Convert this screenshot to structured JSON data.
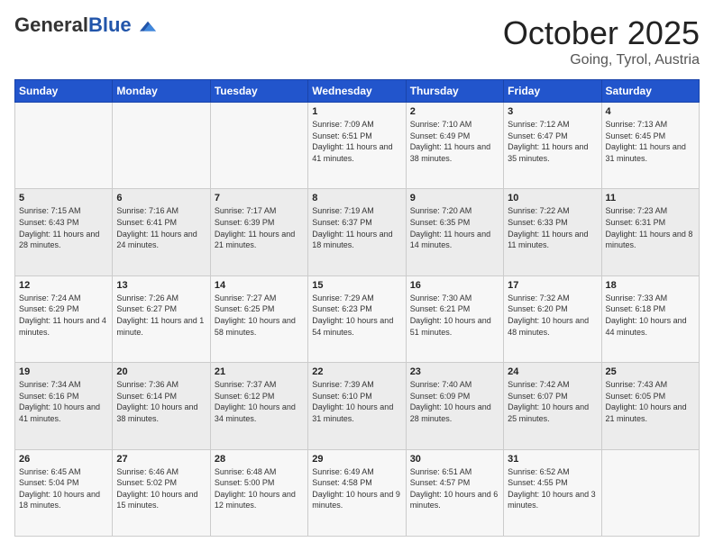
{
  "header": {
    "logo_general": "General",
    "logo_blue": "Blue",
    "month_title": "October 2025",
    "location": "Going, Tyrol, Austria"
  },
  "days_of_week": [
    "Sunday",
    "Monday",
    "Tuesday",
    "Wednesday",
    "Thursday",
    "Friday",
    "Saturday"
  ],
  "weeks": [
    [
      {
        "day": "",
        "sunrise": "",
        "sunset": "",
        "daylight": ""
      },
      {
        "day": "",
        "sunrise": "",
        "sunset": "",
        "daylight": ""
      },
      {
        "day": "",
        "sunrise": "",
        "sunset": "",
        "daylight": ""
      },
      {
        "day": "1",
        "sunrise": "Sunrise: 7:09 AM",
        "sunset": "Sunset: 6:51 PM",
        "daylight": "Daylight: 11 hours and 41 minutes."
      },
      {
        "day": "2",
        "sunrise": "Sunrise: 7:10 AM",
        "sunset": "Sunset: 6:49 PM",
        "daylight": "Daylight: 11 hours and 38 minutes."
      },
      {
        "day": "3",
        "sunrise": "Sunrise: 7:12 AM",
        "sunset": "Sunset: 6:47 PM",
        "daylight": "Daylight: 11 hours and 35 minutes."
      },
      {
        "day": "4",
        "sunrise": "Sunrise: 7:13 AM",
        "sunset": "Sunset: 6:45 PM",
        "daylight": "Daylight: 11 hours and 31 minutes."
      }
    ],
    [
      {
        "day": "5",
        "sunrise": "Sunrise: 7:15 AM",
        "sunset": "Sunset: 6:43 PM",
        "daylight": "Daylight: 11 hours and 28 minutes."
      },
      {
        "day": "6",
        "sunrise": "Sunrise: 7:16 AM",
        "sunset": "Sunset: 6:41 PM",
        "daylight": "Daylight: 11 hours and 24 minutes."
      },
      {
        "day": "7",
        "sunrise": "Sunrise: 7:17 AM",
        "sunset": "Sunset: 6:39 PM",
        "daylight": "Daylight: 11 hours and 21 minutes."
      },
      {
        "day": "8",
        "sunrise": "Sunrise: 7:19 AM",
        "sunset": "Sunset: 6:37 PM",
        "daylight": "Daylight: 11 hours and 18 minutes."
      },
      {
        "day": "9",
        "sunrise": "Sunrise: 7:20 AM",
        "sunset": "Sunset: 6:35 PM",
        "daylight": "Daylight: 11 hours and 14 minutes."
      },
      {
        "day": "10",
        "sunrise": "Sunrise: 7:22 AM",
        "sunset": "Sunset: 6:33 PM",
        "daylight": "Daylight: 11 hours and 11 minutes."
      },
      {
        "day": "11",
        "sunrise": "Sunrise: 7:23 AM",
        "sunset": "Sunset: 6:31 PM",
        "daylight": "Daylight: 11 hours and 8 minutes."
      }
    ],
    [
      {
        "day": "12",
        "sunrise": "Sunrise: 7:24 AM",
        "sunset": "Sunset: 6:29 PM",
        "daylight": "Daylight: 11 hours and 4 minutes."
      },
      {
        "day": "13",
        "sunrise": "Sunrise: 7:26 AM",
        "sunset": "Sunset: 6:27 PM",
        "daylight": "Daylight: 11 hours and 1 minute."
      },
      {
        "day": "14",
        "sunrise": "Sunrise: 7:27 AM",
        "sunset": "Sunset: 6:25 PM",
        "daylight": "Daylight: 10 hours and 58 minutes."
      },
      {
        "day": "15",
        "sunrise": "Sunrise: 7:29 AM",
        "sunset": "Sunset: 6:23 PM",
        "daylight": "Daylight: 10 hours and 54 minutes."
      },
      {
        "day": "16",
        "sunrise": "Sunrise: 7:30 AM",
        "sunset": "Sunset: 6:21 PM",
        "daylight": "Daylight: 10 hours and 51 minutes."
      },
      {
        "day": "17",
        "sunrise": "Sunrise: 7:32 AM",
        "sunset": "Sunset: 6:20 PM",
        "daylight": "Daylight: 10 hours and 48 minutes."
      },
      {
        "day": "18",
        "sunrise": "Sunrise: 7:33 AM",
        "sunset": "Sunset: 6:18 PM",
        "daylight": "Daylight: 10 hours and 44 minutes."
      }
    ],
    [
      {
        "day": "19",
        "sunrise": "Sunrise: 7:34 AM",
        "sunset": "Sunset: 6:16 PM",
        "daylight": "Daylight: 10 hours and 41 minutes."
      },
      {
        "day": "20",
        "sunrise": "Sunrise: 7:36 AM",
        "sunset": "Sunset: 6:14 PM",
        "daylight": "Daylight: 10 hours and 38 minutes."
      },
      {
        "day": "21",
        "sunrise": "Sunrise: 7:37 AM",
        "sunset": "Sunset: 6:12 PM",
        "daylight": "Daylight: 10 hours and 34 minutes."
      },
      {
        "day": "22",
        "sunrise": "Sunrise: 7:39 AM",
        "sunset": "Sunset: 6:10 PM",
        "daylight": "Daylight: 10 hours and 31 minutes."
      },
      {
        "day": "23",
        "sunrise": "Sunrise: 7:40 AM",
        "sunset": "Sunset: 6:09 PM",
        "daylight": "Daylight: 10 hours and 28 minutes."
      },
      {
        "day": "24",
        "sunrise": "Sunrise: 7:42 AM",
        "sunset": "Sunset: 6:07 PM",
        "daylight": "Daylight: 10 hours and 25 minutes."
      },
      {
        "day": "25",
        "sunrise": "Sunrise: 7:43 AM",
        "sunset": "Sunset: 6:05 PM",
        "daylight": "Daylight: 10 hours and 21 minutes."
      }
    ],
    [
      {
        "day": "26",
        "sunrise": "Sunrise: 6:45 AM",
        "sunset": "Sunset: 5:04 PM",
        "daylight": "Daylight: 10 hours and 18 minutes."
      },
      {
        "day": "27",
        "sunrise": "Sunrise: 6:46 AM",
        "sunset": "Sunset: 5:02 PM",
        "daylight": "Daylight: 10 hours and 15 minutes."
      },
      {
        "day": "28",
        "sunrise": "Sunrise: 6:48 AM",
        "sunset": "Sunset: 5:00 PM",
        "daylight": "Daylight: 10 hours and 12 minutes."
      },
      {
        "day": "29",
        "sunrise": "Sunrise: 6:49 AM",
        "sunset": "Sunset: 4:58 PM",
        "daylight": "Daylight: 10 hours and 9 minutes."
      },
      {
        "day": "30",
        "sunrise": "Sunrise: 6:51 AM",
        "sunset": "Sunset: 4:57 PM",
        "daylight": "Daylight: 10 hours and 6 minutes."
      },
      {
        "day": "31",
        "sunrise": "Sunrise: 6:52 AM",
        "sunset": "Sunset: 4:55 PM",
        "daylight": "Daylight: 10 hours and 3 minutes."
      },
      {
        "day": "",
        "sunrise": "",
        "sunset": "",
        "daylight": ""
      }
    ]
  ]
}
